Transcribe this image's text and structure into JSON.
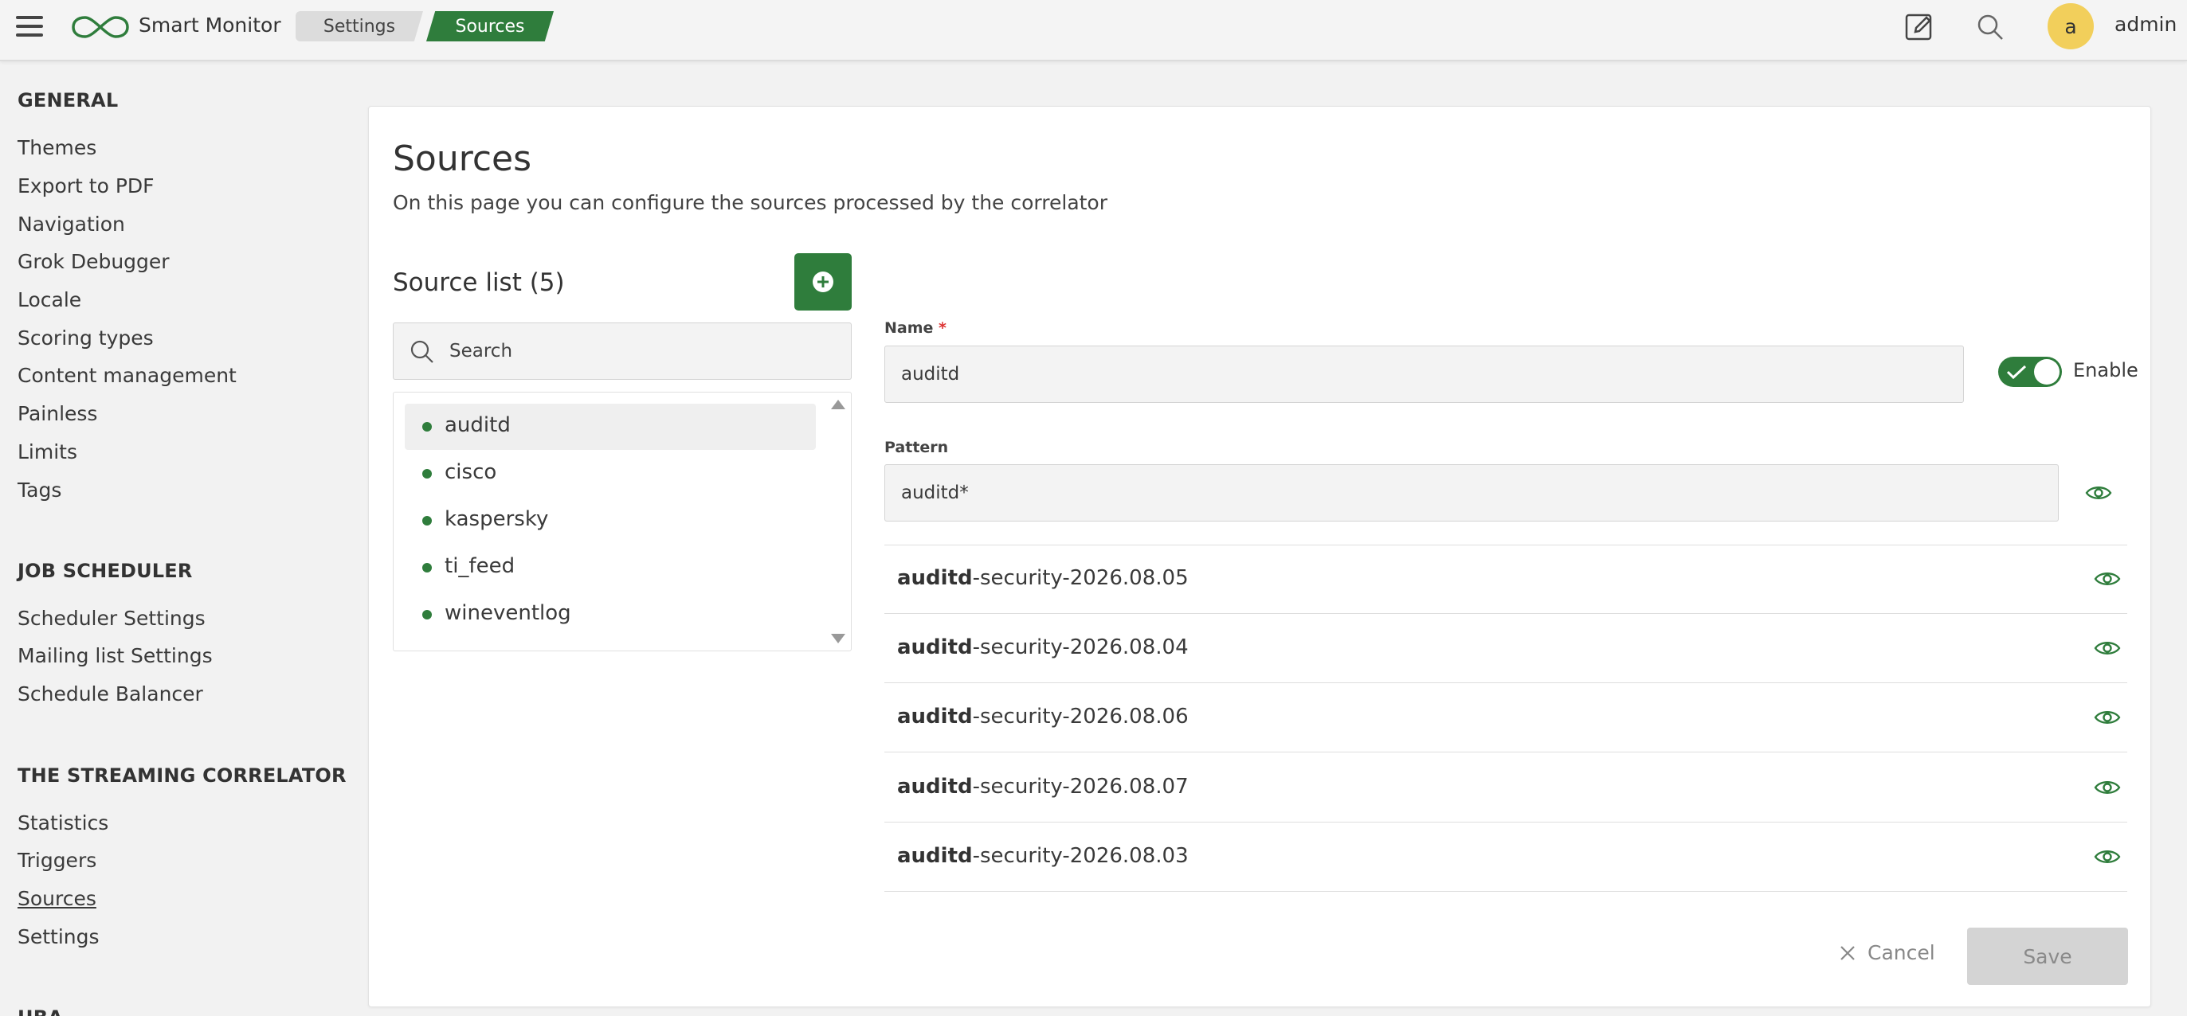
{
  "header": {
    "brand": "Smart Monitor",
    "breadcrumbs": [
      "Settings",
      "Sources"
    ],
    "avatar_letter": "a",
    "username": "admin"
  },
  "sidebar": {
    "sections": [
      {
        "heading": "GENERAL",
        "items": [
          "Themes",
          "Export to PDF",
          "Navigation",
          "Grok Debugger",
          "Locale",
          "Scoring types",
          "Content management",
          "Painless",
          "Limits",
          "Tags"
        ]
      },
      {
        "heading": "JOB SCHEDULER",
        "items": [
          "Scheduler Settings",
          "Mailing list Settings",
          "Schedule Balancer"
        ]
      },
      {
        "heading": "THE STREAMING CORRELATOR",
        "items": [
          "Statistics",
          "Triggers",
          "Sources",
          "Settings"
        ]
      },
      {
        "heading": "UBA",
        "items": []
      }
    ],
    "active_item": "Sources"
  },
  "main": {
    "title": "Sources",
    "subtitle": "On this page you can configure the sources processed by the correlator",
    "list_title": "Source list (5)",
    "search_placeholder": "Search",
    "sources": [
      "auditd",
      "cisco",
      "kaspersky",
      "ti_feed",
      "wineventlog"
    ],
    "selected_source": "auditd",
    "form": {
      "name_label": "Name",
      "name_required_mark": "*",
      "name_value": "auditd",
      "enable_label": "Enable",
      "enabled": true,
      "pattern_label": "Pattern",
      "pattern_value": "auditd*"
    },
    "indices": [
      {
        "bold": "auditd",
        "rest": "-security-2026.08.05"
      },
      {
        "bold": "auditd",
        "rest": "-security-2026.08.04"
      },
      {
        "bold": "auditd",
        "rest": "-security-2026.08.06"
      },
      {
        "bold": "auditd",
        "rest": "-security-2026.08.07"
      },
      {
        "bold": "auditd",
        "rest": "-security-2026.08.03"
      }
    ],
    "cancel_label": "Cancel",
    "save_label": "Save"
  },
  "colors": {
    "accent": "#2f7d3c",
    "avatar": "#f2cf5b",
    "required": "#dd3333"
  }
}
